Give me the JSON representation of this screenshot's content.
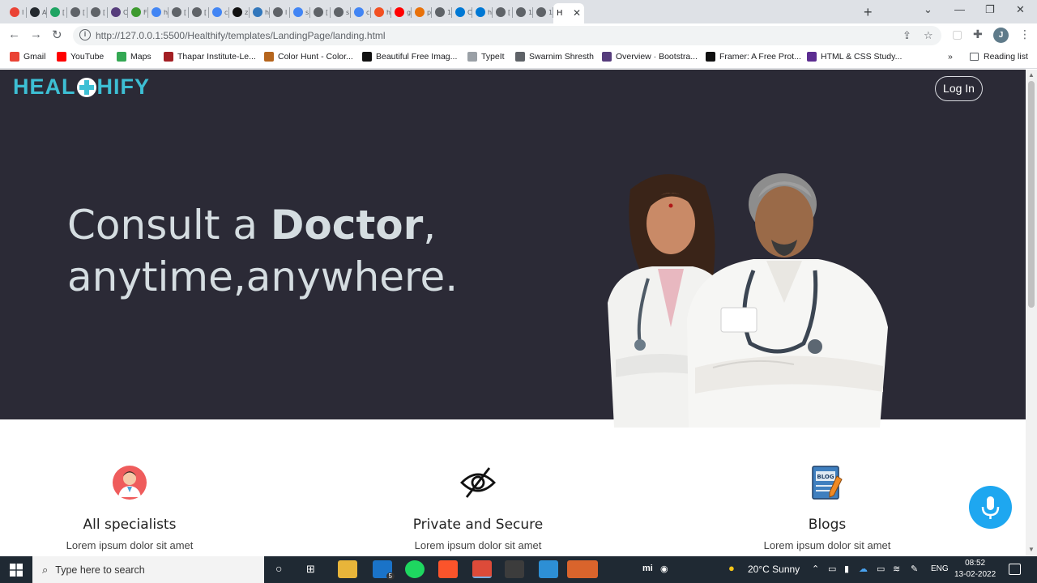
{
  "browser": {
    "tabs": [
      {
        "icon": "gmail-icon",
        "color": "#ea4335",
        "short": "I"
      },
      {
        "icon": "github-icon",
        "color": "#24292e",
        "short": "A"
      },
      {
        "icon": "drive-icon",
        "color": "#1fa463",
        "short": "["
      },
      {
        "icon": "globe-icon",
        "color": "#5f6368",
        "short": "["
      },
      {
        "icon": "globe-icon",
        "color": "#5f6368",
        "short": "["
      },
      {
        "icon": "bootstrap-icon",
        "color": "#563d7c",
        "short": "C"
      },
      {
        "icon": "webflow-icon",
        "color": "#3d9a2f",
        "short": "F"
      },
      {
        "icon": "google-icon",
        "color": "#4285f4",
        "short": "h"
      },
      {
        "icon": "globe-icon",
        "color": "#5f6368",
        "short": "["
      },
      {
        "icon": "globe-icon",
        "color": "#5f6368",
        "short": "["
      },
      {
        "icon": "google-icon",
        "color": "#4285f4",
        "short": "c"
      },
      {
        "icon": "app-icon",
        "color": "#111111",
        "short": "z"
      },
      {
        "icon": "edge-icon",
        "color": "#3277bc",
        "short": "h"
      },
      {
        "icon": "globe-icon",
        "color": "#5f6368",
        "short": "l"
      },
      {
        "icon": "google-icon",
        "color": "#4285f4",
        "short": "s"
      },
      {
        "icon": "globe-icon",
        "color": "#5f6368",
        "short": "["
      },
      {
        "icon": "globe-icon",
        "color": "#5f6368",
        "short": "s"
      },
      {
        "icon": "google-icon",
        "color": "#4285f4",
        "short": "c"
      },
      {
        "icon": "grid-icon",
        "color": "#f25022",
        "short": "h"
      },
      {
        "icon": "youtube-icon",
        "color": "#ff0000",
        "short": "g"
      },
      {
        "icon": "pen-icon",
        "color": "#e8710a",
        "short": "p"
      },
      {
        "icon": "globe-icon",
        "color": "#5f6368",
        "short": "1"
      },
      {
        "icon": "azure-icon",
        "color": "#0078d4",
        "short": "C"
      },
      {
        "icon": "azure-icon",
        "color": "#0078d4",
        "short": "h"
      },
      {
        "icon": "globe-icon",
        "color": "#5f6368",
        "short": "["
      },
      {
        "icon": "globe-icon",
        "color": "#5f6368",
        "short": "1"
      },
      {
        "icon": "globe-icon",
        "color": "#5f6368",
        "short": "1"
      }
    ],
    "active_tab_label": "H",
    "close_glyph": "✕",
    "new_tab_glyph": "+",
    "url": "http://127.0.0.1:5500/Healthify/templates/LandingPage/landing.html",
    "profile_initial": "J",
    "bookmarks": [
      {
        "label": "Gmail",
        "icon": "gmail-icon",
        "color": "#ea4335"
      },
      {
        "label": "YouTube",
        "icon": "youtube-icon",
        "color": "#ff0000"
      },
      {
        "label": "Maps",
        "icon": "maps-icon",
        "color": "#34a853"
      },
      {
        "label": "Thapar Institute-Le...",
        "icon": "thapar-icon",
        "color": "#a31f24"
      },
      {
        "label": "Color Hunt - Color...",
        "icon": "colorhunt-icon",
        "color": "#b5651d"
      },
      {
        "label": "Beautiful Free Imag...",
        "icon": "unsplash-icon",
        "color": "#111111"
      },
      {
        "label": "TypeIt",
        "icon": "typeit-icon",
        "color": "#9aa0a6"
      },
      {
        "label": "Swarnim Shresth",
        "icon": "globe-icon",
        "color": "#5f6368"
      },
      {
        "label": "Overview · Bootstra...",
        "icon": "bootstrap-icon",
        "color": "#563d7c"
      },
      {
        "label": "Framer: A Free Prot...",
        "icon": "framer-icon",
        "color": "#111111"
      },
      {
        "label": "HTML & CSS Study...",
        "icon": "study-icon",
        "color": "#5c2d91"
      }
    ],
    "bookmarks_more": "»",
    "reading_list": "Reading list"
  },
  "page": {
    "logo_left": "HEAL",
    "logo_right": "HIFY",
    "login_label": "Log In",
    "headline_1a": "Consult a ",
    "headline_1b": "Doctor",
    "headline_1c": ",",
    "headline_2": "anytime,anywhere.",
    "features": [
      {
        "title": "All specialists",
        "desc": "Lorem ipsum dolor sit amet",
        "icon": "doctor-avatar-icon"
      },
      {
        "title": "Private and Secure",
        "desc": "Lorem ipsum dolor sit amet",
        "icon": "eye-slash-icon"
      },
      {
        "title": "Blogs",
        "desc": "Lorem ipsum dolor sit amet",
        "icon": "blog-icon"
      }
    ],
    "colors": {
      "hero_bg": "#2b2a36",
      "logo": "#3dbfd4",
      "mic": "#1ea7f0"
    }
  },
  "taskbar": {
    "search_placeholder": "Type here to search",
    "mail_badge": "5",
    "weather": "20°C  Sunny",
    "language": "ENG",
    "time": "08:52",
    "date": "13-02-2022",
    "mi_label": "mi"
  }
}
